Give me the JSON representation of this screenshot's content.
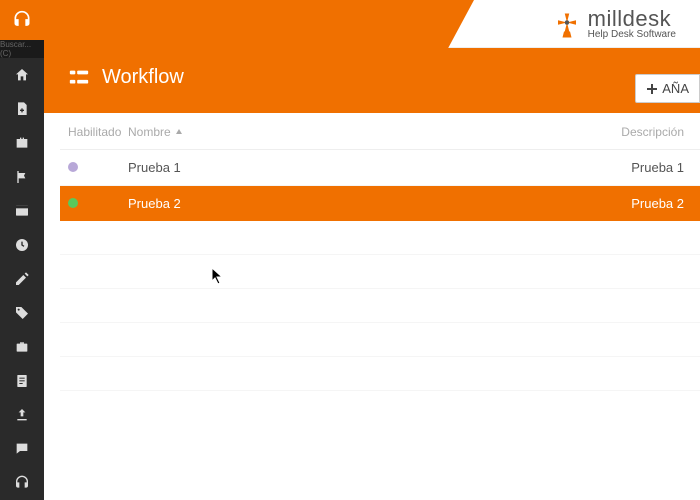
{
  "brand": {
    "name": "milldesk",
    "subtitle": "Help Desk Software"
  },
  "sidebar": {
    "search_placeholder": "Buscar... (C)",
    "items": [
      {
        "icon": "headset"
      },
      {
        "icon": "home"
      },
      {
        "icon": "document-plus"
      },
      {
        "icon": "briefcase"
      },
      {
        "icon": "flag"
      },
      {
        "icon": "window"
      },
      {
        "icon": "clock"
      },
      {
        "icon": "pencil"
      },
      {
        "icon": "tag"
      },
      {
        "icon": "suitcase"
      },
      {
        "icon": "form"
      },
      {
        "icon": "upload"
      },
      {
        "icon": "chat"
      },
      {
        "icon": "headset"
      }
    ]
  },
  "header": {
    "title": "Workflow",
    "add_label": "AÑA"
  },
  "table": {
    "columns": {
      "enabled": "Habilitado",
      "name": "Nombre",
      "description": "Descripción"
    },
    "rows": [
      {
        "enabled_color": "#b8a8d8",
        "name": "Prueba 1",
        "description": "Prueba 1",
        "selected": false
      },
      {
        "enabled_color": "#5bc85b",
        "name": "Prueba 2",
        "description": "Prueba 2",
        "selected": true
      }
    ]
  },
  "colors": {
    "accent": "#f07000"
  }
}
